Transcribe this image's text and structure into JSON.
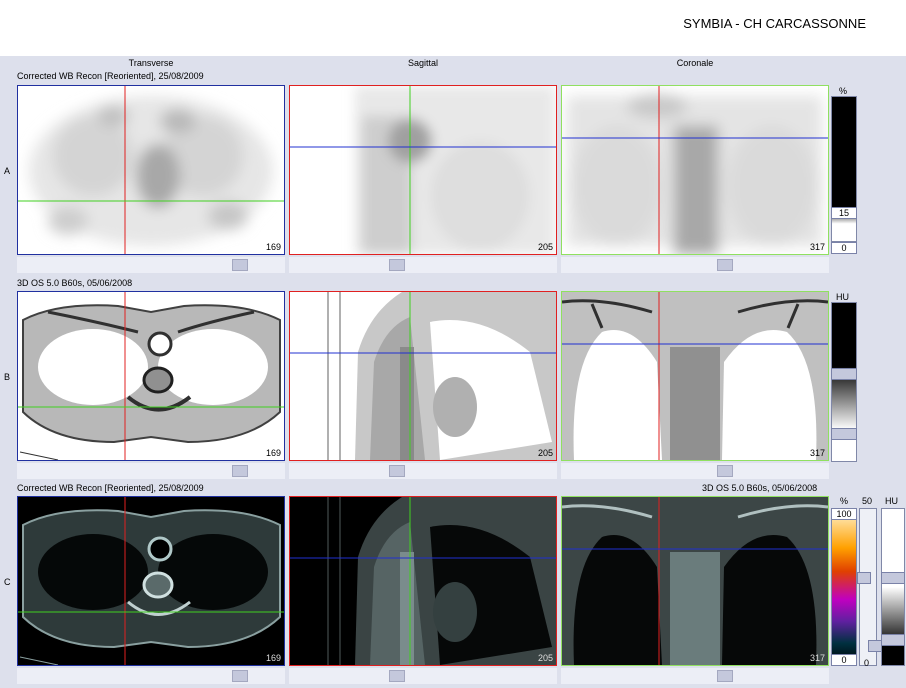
{
  "header": {
    "site_title": "SYMBIA - CH CARCASSONNE"
  },
  "columns": [
    "Transverse",
    "Sagittal",
    "Coronale"
  ],
  "rows": [
    {
      "label": "A",
      "series": "Corrected WB Recon [Reoriented], 25/08/2009",
      "series_right": ""
    },
    {
      "label": "B",
      "series": "3D  OS  5.0  B60s, 05/06/2008",
      "series_right": ""
    },
    {
      "label": "C",
      "series": "Corrected WB Recon [Reoriented], 25/08/2009",
      "series_right": "3D  OS  5.0  B60s, 05/06/2008"
    }
  ],
  "slice_numbers": {
    "transverse": "169",
    "sagittal": "205",
    "coronale": "317"
  },
  "colorbars": {
    "a": {
      "unit": "%",
      "window_value": "15",
      "min_value": "0"
    },
    "b": {
      "unit": "HU"
    },
    "c": {
      "unit_left": "%",
      "unit_mid": "50",
      "unit_right": "HU",
      "max_value": "100",
      "min_value": "0",
      "mid_min": "0"
    }
  },
  "colors": {
    "crosshair_red": "#e02020",
    "crosshair_green": "#40d020",
    "crosshair_blue": "#2030d0",
    "frame_blue": "#2030a0",
    "frame_red": "#e02020",
    "frame_green": "#90e060"
  }
}
